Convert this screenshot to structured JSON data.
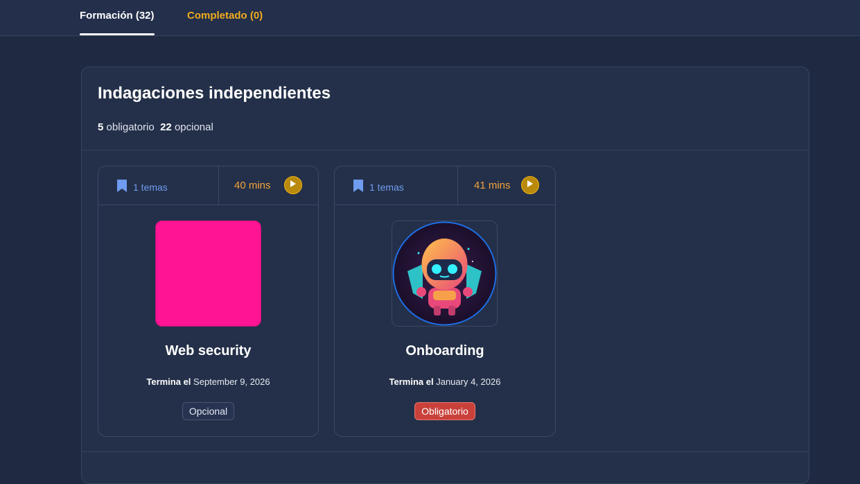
{
  "tabs": [
    {
      "label": "Formación (32)",
      "active": true
    },
    {
      "label": "Completado (0)",
      "active": false
    }
  ],
  "section": {
    "title": "Indagaciones independientes",
    "required_count": "5",
    "required_label": "obligatorio",
    "optional_count": "22",
    "optional_label": "opcional"
  },
  "cards": [
    {
      "topics": "1 temas",
      "duration": "40 mins",
      "thumbnail_color": "#ff1493",
      "title": "Web security",
      "ends_label": "Termina el",
      "ends_date": "September 9, 2026",
      "badge": "Opcional"
    },
    {
      "topics": "1 temas",
      "duration": "41 mins",
      "thumbnail_icon": "robot-avatar",
      "title": "Onboarding",
      "ends_label": "Termina el",
      "ends_date": "January 4, 2026",
      "badge": "Obligatorio"
    }
  ],
  "colors": {
    "accent_tab": "#f0ad1f",
    "topics_blue": "#6f9cf0",
    "duration_orange": "#f4a23c",
    "required_red": "#c9413a"
  }
}
